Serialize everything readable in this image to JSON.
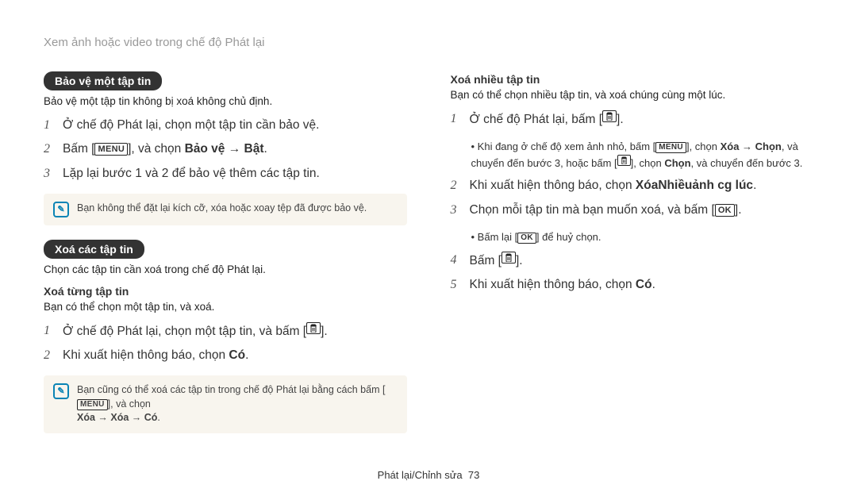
{
  "breadcrumb": "Xem ảnh hoặc video trong chế độ Phát lại",
  "left": {
    "protect": {
      "title": "Bảo vệ một tập tin",
      "caption": "Bảo vệ một tập tin không bị xoá không chủ định.",
      "step1": "Ở chế độ Phát lại, chọn một tập tin cần bảo vệ.",
      "step2a": "Bấm [",
      "step2b": "], và chọn ",
      "step2c": "Bảo vệ → Bật",
      "step2d": ".",
      "step3": "Lặp lại bước 1 và 2 để bảo vệ thêm các tập tin.",
      "note": "Bạn không thể đặt lại kích cỡ, xóa hoặc xoay tệp đã được bảo vệ."
    },
    "delete": {
      "title": "Xoá các tập tin",
      "caption": "Chọn các tập tin cần xoá trong chế độ Phát lại.",
      "single": {
        "title": "Xoá từng tập tin",
        "caption": "Bạn có thể chọn một tập tin, và xoá.",
        "step1a": "Ở chế độ Phát lại, chọn một tập tin, và bấm [",
        "step1b": "].",
        "step2a": "Khi xuất hiện thông báo, chọn ",
        "step2b": "Có",
        "step2c": "."
      },
      "note_a": "Bạn cũng có thể xoá các tập tin trong chế độ Phát lại bằng cách bấm [",
      "note_b": "], và chọn ",
      "note_c": "Xóa → Xóa → Có",
      "note_d": "."
    }
  },
  "right": {
    "multi": {
      "title": "Xoá nhiều tập tin",
      "caption": "Bạn có thể chọn nhiều tập tin, và xoá chúng cùng một lúc.",
      "step1a": "Ở chế độ Phát lại, bấm [",
      "step1b": "].",
      "sub1a": "Khi đang ở chế độ xem ảnh nhỏ, bấm [",
      "sub1b": "], chọn ",
      "sub1c": "Xóa → Chọn",
      "sub1d": ", và chuyển đến bước 3, hoặc bấm [",
      "sub1e": "], chọn ",
      "sub1f": "Chọn",
      "sub1g": ", và chuyển đến bước 3.",
      "step2a": "Khi xuất hiện thông báo, chọn ",
      "step2b": "XóaNhiềuảnh cg lúc",
      "step2c": ".",
      "step3a": "Chọn mỗi tập tin mà bạn muốn xoá, và bấm [",
      "step3b": "].",
      "sub3a": "Bấm lại [",
      "sub3b": "] để huỷ chọn.",
      "step4a": "Bấm [",
      "step4b": "].",
      "step5a": "Khi xuất hiện thông báo, chọn ",
      "step5b": "Có",
      "step5c": "."
    }
  },
  "labels": {
    "menu": "MENU",
    "ok": "OK"
  },
  "footer": {
    "section": "Phát lại/Chỉnh sửa",
    "page": "73"
  }
}
